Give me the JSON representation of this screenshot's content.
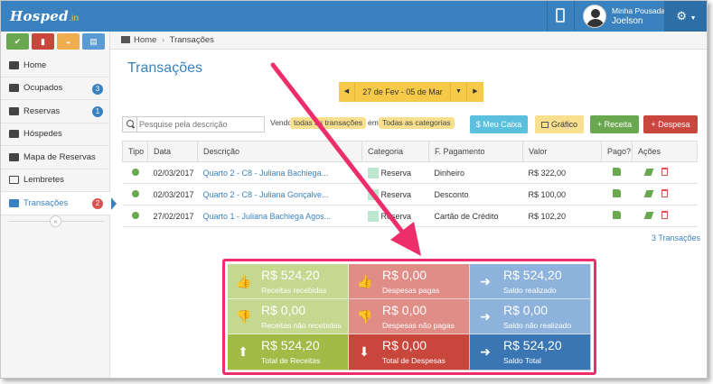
{
  "app": {
    "logo": "Hosped",
    "logo_suffix": ".in"
  },
  "user": {
    "subtitle": "Minha Pousada",
    "name": "Joelson"
  },
  "topbar": {
    "device_icon": "tablet-icon",
    "settings_icon": "gear-icon"
  },
  "quick_buttons": [
    {
      "icon": "check-icon",
      "color": "#6aa84f"
    },
    {
      "icon": "door-icon",
      "color": "#c9463d"
    },
    {
      "icon": "inbox-icon",
      "color": "#f0ad4e"
    },
    {
      "icon": "book-icon",
      "color": "#5b9bd5"
    }
  ],
  "sidebar": {
    "items": [
      {
        "label": "Home",
        "icon": "wrench-icon",
        "badge": ""
      },
      {
        "label": "Ocupados",
        "icon": "sign-in-icon",
        "badge": "3",
        "badge_color": "#3a82bf"
      },
      {
        "label": "Reservas",
        "icon": "book-icon",
        "badge": "1",
        "badge_color": "#3a82bf"
      },
      {
        "label": "Hóspedes",
        "icon": "users-icon",
        "badge": ""
      },
      {
        "label": "Mapa de Reservas",
        "icon": "table-icon",
        "badge": ""
      },
      {
        "label": "Lembretes",
        "icon": "envelope-icon",
        "badge": ""
      },
      {
        "label": "Transações",
        "icon": "money-icon",
        "badge": "2",
        "badge_color": "#d9534f",
        "active": true
      }
    ],
    "collapse_glyph": "«"
  },
  "breadcrumb": {
    "home": "Home",
    "separator": "›",
    "current": "Transações"
  },
  "page": {
    "title": "Transações"
  },
  "date_range": {
    "label": "27 de Fev - 05 de Mar",
    "prev": "◀",
    "next": "▶",
    "dropdown": "▼"
  },
  "search": {
    "placeholder": "Pesquise pela descrição"
  },
  "filters": {
    "prefix": "Vendo",
    "transactions": "todas as transações",
    "middle": "em",
    "categories": "Todas as categorias"
  },
  "actions": {
    "caixa": "$ Meu Caixa",
    "grafico": "Gráfico",
    "receita": "+ Receita",
    "despesa": "+ Despesa"
  },
  "table": {
    "headers": [
      "Tipo",
      "Data",
      "Descrição",
      "Categoria",
      "F. Pagamento",
      "Valor",
      "Pago?",
      "Ações"
    ],
    "rows": [
      {
        "date": "02/03/2017",
        "description": "Quarto 2 - C8 - Juliana Bachiega...",
        "category": "Reserva",
        "payment": "Dinheiro",
        "value": "R$ 322,00"
      },
      {
        "date": "02/03/2017",
        "description": "Quarto 2 - C8 - Juliana Gonçalve...",
        "category": "Reserva",
        "payment": "Desconto",
        "value": "R$ 100,00"
      },
      {
        "date": "27/02/2017",
        "description": "Quarto 1 - Juliana Bachiega Agos...",
        "category": "Reserva",
        "payment": "Cartão de Crédito",
        "value": "R$ 102,20"
      }
    ],
    "count": "3 Transações"
  },
  "summary": [
    {
      "value": "R$ 524,20",
      "label": "Receitas recebidas",
      "icon": "thumbs-up-icon",
      "glyph": "👍",
      "color": "#c5d88f"
    },
    {
      "value": "R$ 0,00",
      "label": "Despesas pagas",
      "icon": "thumbs-up-icon",
      "glyph": "👍",
      "color": "#e08c87"
    },
    {
      "value": "R$ 524,20",
      "label": "Saldo realizado",
      "icon": "arrow-right-icon",
      "glyph": "➜",
      "color": "#8db3dc"
    },
    {
      "value": "R$ 0,00",
      "label": "Receitas não recebidas",
      "icon": "thumbs-down-icon",
      "glyph": "👎",
      "color": "#c5d88f"
    },
    {
      "value": "R$ 0,00",
      "label": "Despesas não pagas",
      "icon": "thumbs-down-icon",
      "glyph": "👎",
      "color": "#e08c87"
    },
    {
      "value": "R$ 0,00",
      "label": "Saldo não realizado",
      "icon": "arrow-right-icon",
      "glyph": "➜",
      "color": "#8db3dc"
    },
    {
      "value": "R$ 524,20",
      "label": "Total de Receitas",
      "icon": "arrow-up-icon",
      "glyph": "⬆",
      "color": "#a2bb47"
    },
    {
      "value": "R$ 0,00",
      "label": "Total de Despesas",
      "icon": "arrow-down-icon",
      "glyph": "⬇",
      "color": "#c9463d"
    },
    {
      "value": "R$ 524,20",
      "label": "Saldo Total",
      "icon": "arrow-right-icon",
      "glyph": "➜",
      "color": "#3a76b4"
    }
  ],
  "annotation": {
    "color": "#ee2e6b"
  }
}
